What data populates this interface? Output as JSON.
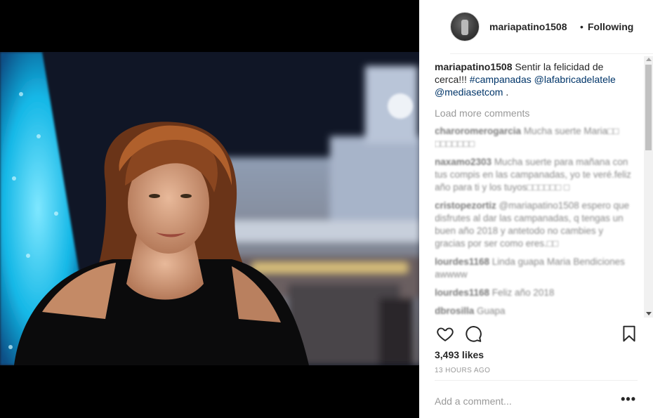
{
  "post": {
    "username": "mariapatino1508",
    "separator": "•",
    "follow_status": "Following",
    "caption": {
      "username": "mariapatino1508",
      "text": " Sentir la felicidad de cerca!!! ",
      "hashtag": "#campanadas",
      "mention1": "@lafabricadelatele",
      "mention2": "@mediasetcom",
      "tail": " ."
    },
    "load_more": "Load more comments",
    "comments": [
      {
        "user": "charoromerogarcia",
        "text": " Mucha suerte Maria□□ □□□□□□□"
      },
      {
        "user": "naxamo2303",
        "text": " Mucha suerte para mañana con tus compis en las campanadas, yo te veré.feliz año para ti y los tuyos□□□□□□ □"
      },
      {
        "user": "cristopezortiz",
        "text": " @mariapatino1508 espero que disfrutes al dar las campanadas, q tengas un buen año 2018 y antetodo no cambies y gracias por ser como eres.□□"
      },
      {
        "user": "lourdes1168",
        "text": " Linda guapa Maria Bendiciones awwww"
      },
      {
        "user": "lourdes1168",
        "text": " Feliz año 2018"
      },
      {
        "user": "dbrosilla",
        "text": " Guapa"
      }
    ],
    "likes": "3,493 likes",
    "time": "13 HOURS AGO",
    "add_comment_placeholder": "Add a comment...",
    "more_label": "•••"
  },
  "icons": {
    "like": "heart-outline-icon",
    "comment": "speech-bubble-icon",
    "save": "bookmark-icon",
    "options": "ellipsis-icon"
  },
  "colors": {
    "text": "#262626",
    "muted": "#999999",
    "link": "#003569",
    "divider": "#efefef"
  }
}
